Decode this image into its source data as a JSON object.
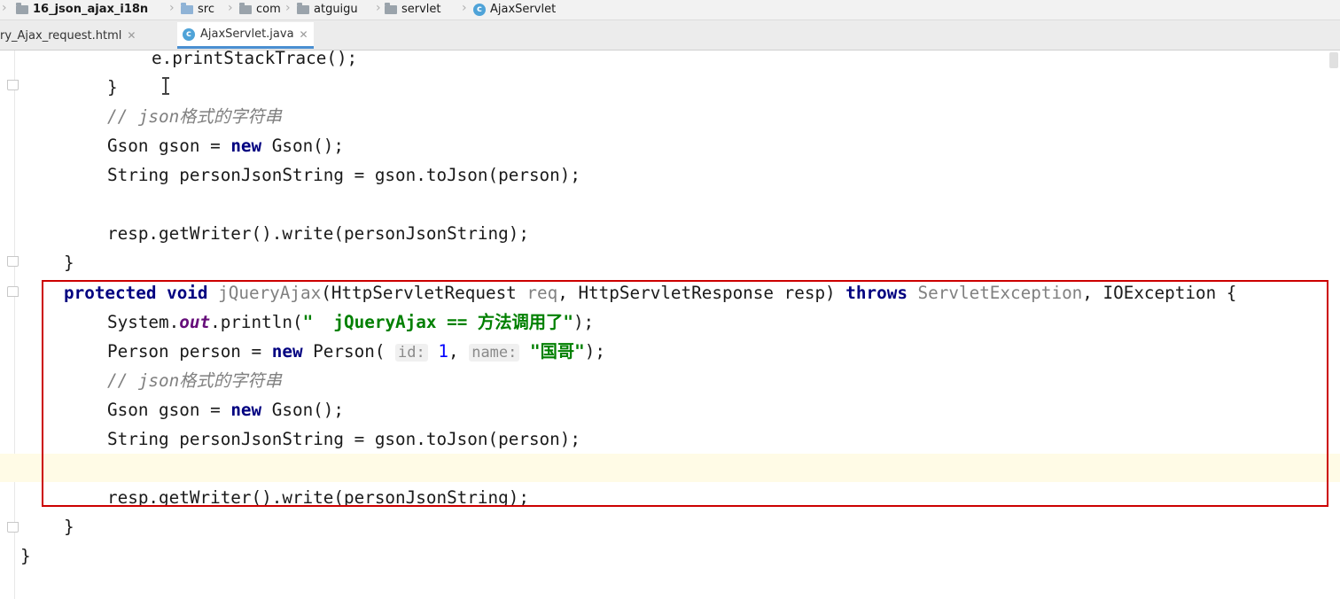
{
  "breadcrumb": {
    "items": [
      {
        "label": "16_json_ajax_i18n",
        "icon": "module-folder-icon"
      },
      {
        "label": "src",
        "icon": "folder-icon"
      },
      {
        "label": "com",
        "icon": "folder-icon"
      },
      {
        "label": "atguigu",
        "icon": "folder-icon"
      },
      {
        "label": "servlet",
        "icon": "folder-icon"
      },
      {
        "label": "AjaxServlet",
        "icon": "class-icon"
      }
    ]
  },
  "tabs": [
    {
      "label": "ry_Ajax_request.html",
      "active": false
    },
    {
      "label": "AjaxServlet.java",
      "active": true
    }
  ],
  "code": {
    "l1": "e.printStackTrace();",
    "l2": "}",
    "l3": "// json格式的字符串",
    "l4a": "Gson gson = ",
    "l4b": "new",
    "l4c": " Gson();",
    "l5": "String personJsonString = gson.toJson(person);",
    "l7": "resp.getWriter().write(personJsonString);",
    "l8": "}",
    "m_kw1": "protected",
    "m_kw2": "void",
    "m_name": "jQueryAjax",
    "m_p1": "(HttpServletRequest ",
    "m_req": "req",
    "m_p2": ", HttpServletResponse resp) ",
    "m_throws": "throws",
    "m_ex1": "ServletException",
    "m_ex2": ", IOException {",
    "p_a": "System.",
    "p_out": "out",
    "p_b": ".println(",
    "p_str": "\"  jQueryAjax == 方法调用了\"",
    "p_c": ");",
    "n_a": "Person person = ",
    "n_new": "new",
    "n_b": " Person( ",
    "n_hint1": "id:",
    "n_num": "1",
    "n_comma": ", ",
    "n_hint2": "name:",
    "n_str": "\"国哥\"",
    "n_c": ");",
    "c2": "// json格式的字符串",
    "g_a": "Gson gson = ",
    "g_new": "new",
    "g_b": " Gson();",
    "s2": "String personJsonString = gson.toJson(person);",
    "w2": "resp.getWriter().write(personJsonString);",
    "close_method": "}",
    "close_class": "}"
  },
  "colors": {
    "keyword": "#000080",
    "comment": "#808080",
    "string": "#008000",
    "number": "#0000ff",
    "highlight_box": "#cc0000",
    "current_line": "#fffbe6"
  }
}
